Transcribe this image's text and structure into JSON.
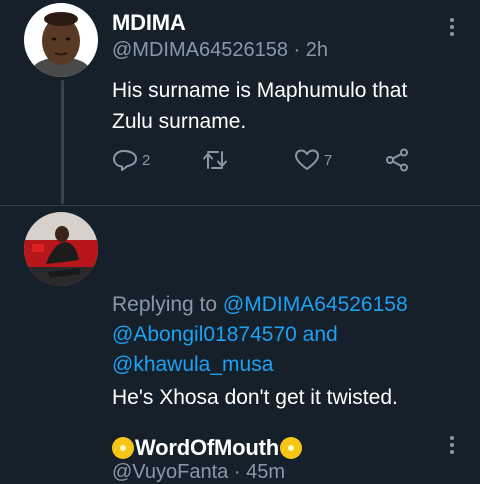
{
  "tweets": [
    {
      "name": "MDIMA",
      "handle": "@MDIMA64526158",
      "time": "2h",
      "text": "His surname is Maphumulo that Zulu surname.",
      "actions": {
        "replies": "2",
        "retweets": "",
        "likes": "7"
      }
    },
    {
      "name": "WordOfMouth",
      "name_emoji": "dvd-disc-icon",
      "handle": "@VuyoFanta",
      "time": "45m",
      "replying_to_label": "Replying to",
      "replying_to_1": "@MDIMA64526158",
      "replying_to_2": "@Abongil01874570",
      "replying_to_and": "and",
      "replying_to_3": "@khawula_musa",
      "text": "He's Xhosa don't get it twisted."
    }
  ],
  "colors": {
    "background": "#15202b",
    "secondary_text": "#8899a6",
    "link": "#1da1f2",
    "divider": "#38444d"
  }
}
